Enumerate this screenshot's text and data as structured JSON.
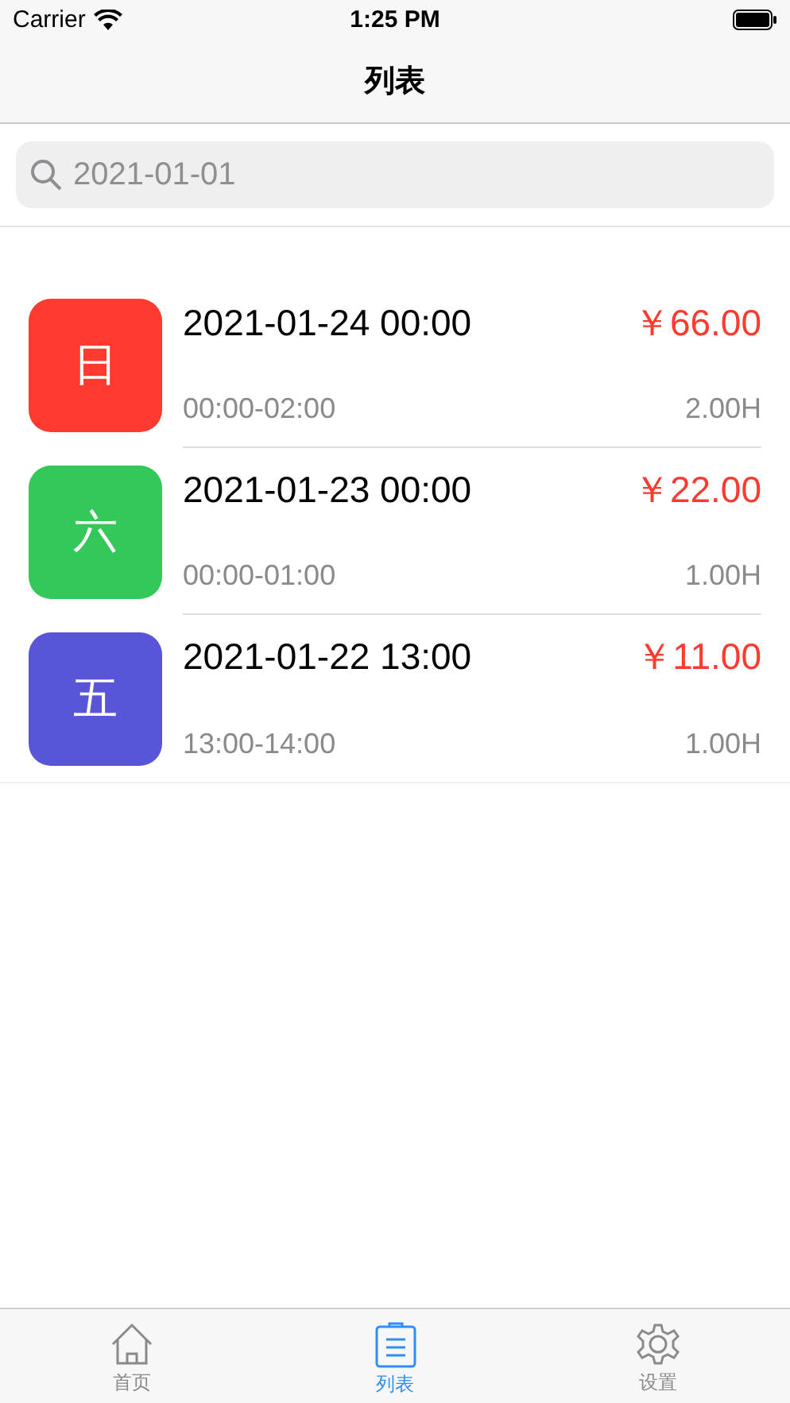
{
  "status_bar": {
    "carrier": "Carrier",
    "time": "1:25 PM"
  },
  "nav": {
    "title": "列表"
  },
  "search": {
    "placeholder": "2021-01-01"
  },
  "records": [
    {
      "weekday": "日",
      "color": "#ff3b30",
      "datetime": "2021-01-24 00:00",
      "amount": "￥66.00",
      "range": "00:00-02:00",
      "hours": "2.00H"
    },
    {
      "weekday": "六",
      "color": "#34c759",
      "datetime": "2021-01-23 00:00",
      "amount": "￥22.00",
      "range": "00:00-01:00",
      "hours": "1.00H"
    },
    {
      "weekday": "五",
      "color": "#5856d6",
      "datetime": "2021-01-22 13:00",
      "amount": "￥11.00",
      "range": "13:00-14:00",
      "hours": "1.00H"
    }
  ],
  "tabs": [
    {
      "kind": "home",
      "label": "首页",
      "selected": false
    },
    {
      "kind": "list",
      "label": "列表",
      "selected": true
    },
    {
      "kind": "settings",
      "label": "设置",
      "selected": false
    }
  ]
}
